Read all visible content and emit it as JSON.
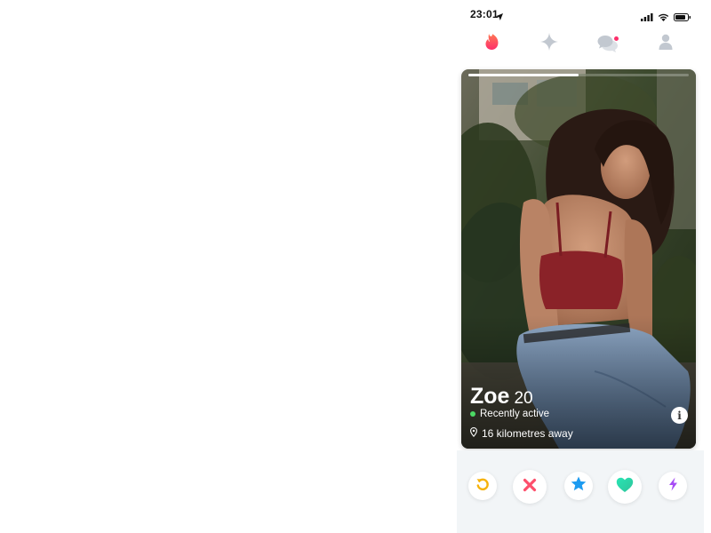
{
  "status_bar": {
    "time": "23:01",
    "icons": [
      "location-arrow-icon",
      "signal-icon",
      "wifi-icon",
      "battery-icon"
    ]
  },
  "top_nav": {
    "items": [
      {
        "name": "discover",
        "icon": "flame-icon",
        "active": true
      },
      {
        "name": "explore",
        "icon": "sparkle-icon",
        "active": false
      },
      {
        "name": "messages",
        "icon": "chat-bubbles-icon",
        "active": false,
        "notification_dot": true
      },
      {
        "name": "profile",
        "icon": "person-icon",
        "active": false
      }
    ]
  },
  "card": {
    "name": "Zoe",
    "age": "20",
    "activity": "Recently active",
    "distance": "16 kilometres away",
    "photo_progress": 0.5,
    "info_label": "i"
  },
  "actions": [
    {
      "name": "rewind",
      "icon": "rewind-icon",
      "color": "#f6b20b"
    },
    {
      "name": "nope",
      "icon": "close-icon",
      "color": "#fd4e6b"
    },
    {
      "name": "super-like",
      "icon": "star-icon",
      "color": "#1d9bf0"
    },
    {
      "name": "like",
      "icon": "heart-icon",
      "color": "#2fd3a3"
    },
    {
      "name": "boost",
      "icon": "lightning-icon",
      "color": "#a64cf5"
    }
  ],
  "colors": {
    "brand": "#fd2f6b",
    "inactive_icon": "#c2c8d0",
    "active_dot": "#4cd964",
    "action_bar_bg": "#f2f5f7"
  }
}
